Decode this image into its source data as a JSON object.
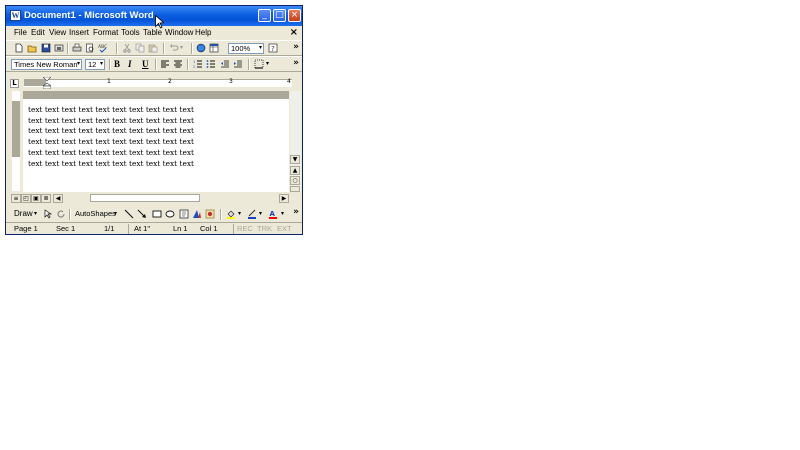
{
  "window": {
    "title": "Document1 - Microsoft Word",
    "app_icon": "W"
  },
  "title_buttons": {
    "minimize": "_",
    "maximize": "□",
    "close": "×"
  },
  "menu": {
    "items": [
      "File",
      "Edit",
      "View",
      "Insert",
      "Format",
      "Tools",
      "Table",
      "Window",
      "Help"
    ],
    "close_label": "×"
  },
  "toolbar": {
    "zoom": "100%",
    "icons": [
      "new-icon",
      "open-icon",
      "save-icon",
      "print-icon",
      "print-preview-icon",
      "spelling-icon",
      "cut-icon",
      "copy-icon",
      "paste-icon",
      "undo-icon",
      "web-icon",
      "table-icon",
      "help-icon"
    ]
  },
  "formatting": {
    "font": "Times New Roman",
    "size": "12",
    "bold": "B",
    "italic": "I",
    "underline": "U"
  },
  "ruler": {
    "numbers": [
      "1",
      "2",
      "3",
      "4"
    ]
  },
  "document": {
    "lines": [
      "text text text text text text text text text text",
      "text text text text text text text text text text",
      "text text text text text text text text text text",
      "text text text text text text text text text text",
      "text text text text text text text text text text",
      "text text text text text text text text text text"
    ]
  },
  "drawing": {
    "draw_label": "Draw",
    "autoshapes_label": "AutoShapes"
  },
  "status": {
    "page": "Page 1",
    "section": "Sec 1",
    "pages": "1/1",
    "at": "At 1\"",
    "line": "Ln 1",
    "col": "Col 1",
    "rec": "REC",
    "trk": "TRK",
    "ext": "EXT"
  },
  "colors": {
    "title_bar": "#0553d6",
    "chrome": "#ece9d8",
    "highlight_yellow": "#ffff00",
    "font_color_red": "#ff0000"
  }
}
